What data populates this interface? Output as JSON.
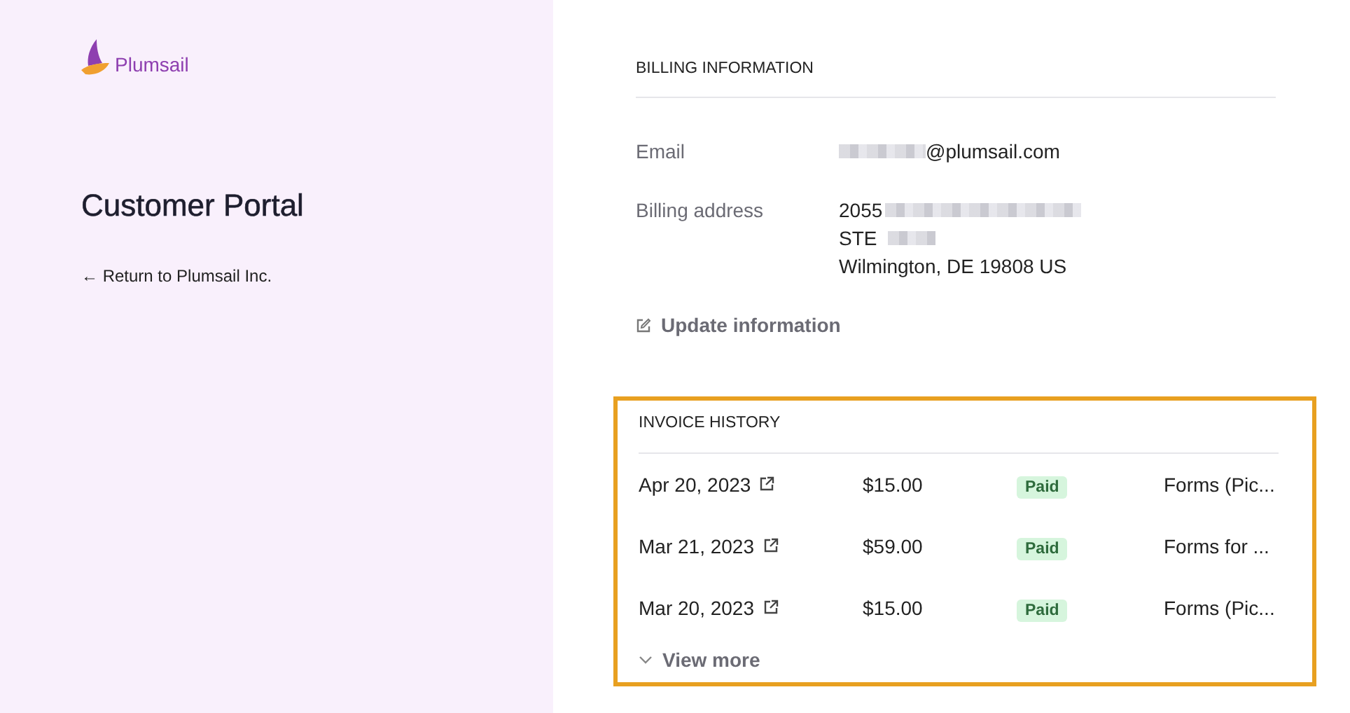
{
  "brand": {
    "name": "Plumsail"
  },
  "sidebar": {
    "title": "Customer Portal",
    "back_link": "← Return to Plumsail Inc."
  },
  "billing": {
    "title": "BILLING INFORMATION",
    "fields": [
      {
        "label": "Email",
        "lines": [
          {
            "text": "@plumsail.com",
            "kind": "masked_prefix"
          }
        ]
      },
      {
        "label": "Billing address",
        "lines": [
          {
            "text": "2055",
            "kind": "masked_suffix"
          },
          {
            "text": "STE",
            "kind": "masked_suffix"
          },
          {
            "text": "Wilmington, DE 19808 US",
            "kind": "plain"
          }
        ]
      }
    ],
    "update_link": "Update information"
  },
  "invoices": {
    "title": "INVOICE HISTORY",
    "highlighted": true,
    "rows": [
      {
        "date": "Apr 20, 2023",
        "amount": "$15.00",
        "status": "Paid",
        "kind": "paid",
        "description": "Forms (Pic..."
      },
      {
        "date": "Mar 21, 2023",
        "amount": "$59.00",
        "status": "Paid",
        "kind": "paid",
        "description": "Forms for ..."
      },
      {
        "date": "Mar 20, 2023",
        "amount": "$15.00",
        "status": "Paid",
        "kind": "paid",
        "description": "Forms (Pic..."
      }
    ],
    "view_more": "View more"
  }
}
